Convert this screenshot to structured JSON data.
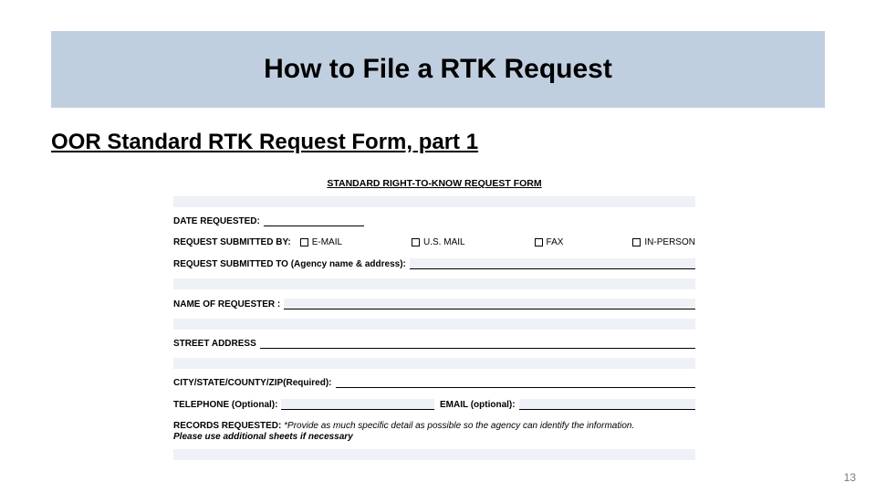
{
  "title": "How to File a RTK Request",
  "subtitle": "OOR Standard RTK Request Form, part 1",
  "page_number": "13",
  "form": {
    "heading": "STANDARD RIGHT-TO-KNOW REQUEST FORM",
    "date_label": "DATE REQUESTED:",
    "submitted_by_label": "REQUEST SUBMITTED BY:",
    "methods": [
      "E-MAIL",
      "U.S. MAIL",
      "FAX",
      "IN-PERSON"
    ],
    "submitted_to_label": "REQUEST SUBMITTED TO (Agency name & address):",
    "name_label": "NAME OF REQUESTER :",
    "street_label": "STREET ADDRESS",
    "cscz_label": "CITY/STATE/COUNTY/ZIP(Required):",
    "phone_label": "TELEPHONE (Optional):",
    "email_label": "EMAIL (optional):",
    "records_label": "RECORDS REQUESTED:",
    "records_hint": "*Provide as much specific detail as possible so the agency can identify the information.",
    "records_note": "Please use additional sheets if necessary"
  }
}
